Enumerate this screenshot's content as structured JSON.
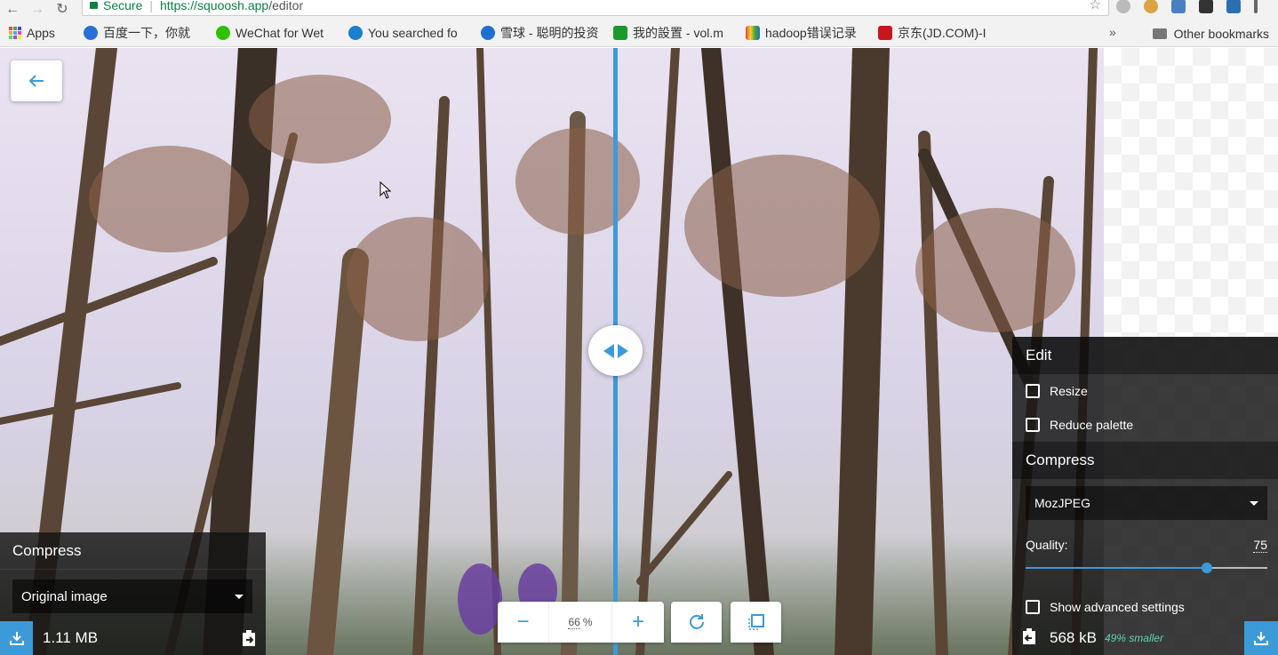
{
  "browser": {
    "secure_label": "Secure",
    "url_host": "https://squoosh.app",
    "url_path": "/editor",
    "bookmarks": [
      {
        "label": "Apps",
        "icon": "apps-grid-icon"
      },
      {
        "label": "百度一下，你就",
        "icon": "baidu-icon",
        "color": "#2a6fd6"
      },
      {
        "label": "WeChat for Wet",
        "icon": "wechat-icon",
        "color": "#2dc100"
      },
      {
        "label": "You searched fo",
        "icon": "snowflake-icon",
        "color": "#1b7fcc"
      },
      {
        "label": "雪球 - 聪明的投资",
        "icon": "xueqiu-icon",
        "color": "#1e6fd0"
      },
      {
        "label": "我的設置 - vol.m",
        "icon": "vol-icon",
        "color": "#1a9a2a"
      },
      {
        "label": "hadoop错误记录",
        "icon": "hadoop-icon",
        "color": "#d43"
      },
      {
        "label": "京东(JD.COM)-I",
        "icon": "jd-icon",
        "color": "#c8161d"
      }
    ],
    "more_label": "»",
    "other_bookmarks": "Other bookmarks"
  },
  "colors": {
    "accent": "#3d9ad8",
    "smaller_text": "#5dd3b1"
  },
  "left_panel": {
    "title": "Compress",
    "method": "Original image",
    "size": "1.11 MB"
  },
  "right_panel": {
    "edit_title": "Edit",
    "resize_label": "Resize",
    "reduce_palette_label": "Reduce palette",
    "compress_title": "Compress",
    "method": "MozJPEG",
    "quality_label": "Quality:",
    "quality_value": "75",
    "quality_fraction": 0.75,
    "advanced_label": "Show advanced settings",
    "size": "568 kB",
    "savings": "49% smaller"
  },
  "zoom": {
    "minus": "−",
    "value": "66",
    "unit": "%",
    "plus": "+"
  }
}
